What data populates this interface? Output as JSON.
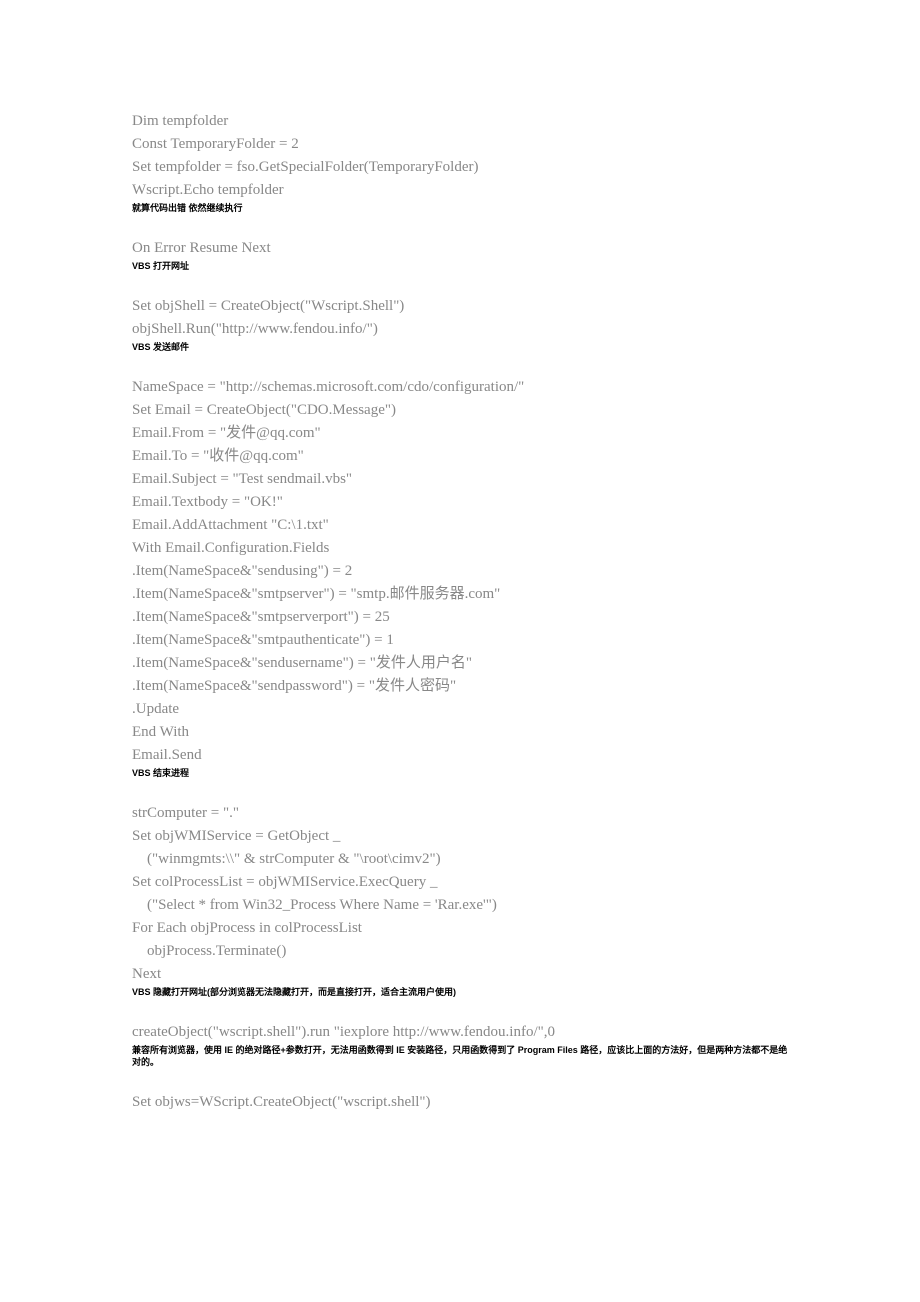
{
  "blocks": [
    {
      "type": "code",
      "lines": [
        "Dim tempfolder",
        "Const TemporaryFolder = 2",
        "Set tempfolder = fso.GetSpecialFolder(TemporaryFolder)",
        "Wscript.Echo tempfolder"
      ]
    },
    {
      "type": "comment",
      "text": "就算代码出错 依然继续执行"
    },
    {
      "type": "blank"
    },
    {
      "type": "code",
      "lines": [
        "On Error Resume Next"
      ]
    },
    {
      "type": "comment",
      "text": "VBS 打开网址"
    },
    {
      "type": "blank"
    },
    {
      "type": "code",
      "lines": [
        "Set objShell = CreateObject(\"Wscript.Shell\")",
        "objShell.Run(\"http://www.fendou.info/\")"
      ]
    },
    {
      "type": "comment",
      "text": "VBS 发送邮件"
    },
    {
      "type": "blank"
    },
    {
      "type": "code",
      "lines": [
        "NameSpace = \"http://schemas.microsoft.com/cdo/configuration/\"",
        "Set Email = CreateObject(\"CDO.Message\")",
        "Email.From = \"发件@qq.com\"",
        "Email.To = \"收件@qq.com\"",
        "Email.Subject = \"Test sendmail.vbs\"",
        "Email.Textbody = \"OK!\"",
        "Email.AddAttachment \"C:\\1.txt\"",
        "With Email.Configuration.Fields",
        ".Item(NameSpace&\"sendusing\") = 2",
        ".Item(NameSpace&\"smtpserver\") = \"smtp.邮件服务器.com\"",
        ".Item(NameSpace&\"smtpserverport\") = 25",
        ".Item(NameSpace&\"smtpauthenticate\") = 1",
        ".Item(NameSpace&\"sendusername\") = \"发件人用户名\"",
        ".Item(NameSpace&\"sendpassword\") = \"发件人密码\"",
        ".Update",
        "End With",
        "Email.Send"
      ]
    },
    {
      "type": "comment",
      "text": "VBS 结束进程"
    },
    {
      "type": "blank"
    },
    {
      "type": "code",
      "lines": [
        "strComputer = \".\"",
        "Set objWMIService = GetObject _",
        "    (\"winmgmts:\\\\\" & strComputer & \"\\root\\cimv2\")",
        "Set colProcessList = objWMIService.ExecQuery _",
        "    (\"Select * from Win32_Process Where Name = 'Rar.exe'\")",
        "For Each objProcess in colProcessList",
        "    objProcess.Terminate()",
        "Next"
      ]
    },
    {
      "type": "comment",
      "text": "VBS 隐藏打开网址(部分浏览器无法隐藏打开，而是直接打开，适合主流用户使用)"
    },
    {
      "type": "blank"
    },
    {
      "type": "code",
      "lines": [
        "createObject(\"wscript.shell\").run \"iexplore http://www.fendou.info/\",0"
      ]
    },
    {
      "type": "comment",
      "text": "兼容所有浏览器，使用 IE 的绝对路径+参数打开，无法用函数得到 IE 安装路径，只用函数得到了 Program Files 路径，应该比上面的方法好，但是两种方法都不是绝对的。"
    },
    {
      "type": "blank"
    },
    {
      "type": "code",
      "lines": [
        "Set objws=WScript.CreateObject(\"wscript.shell\")"
      ]
    }
  ]
}
